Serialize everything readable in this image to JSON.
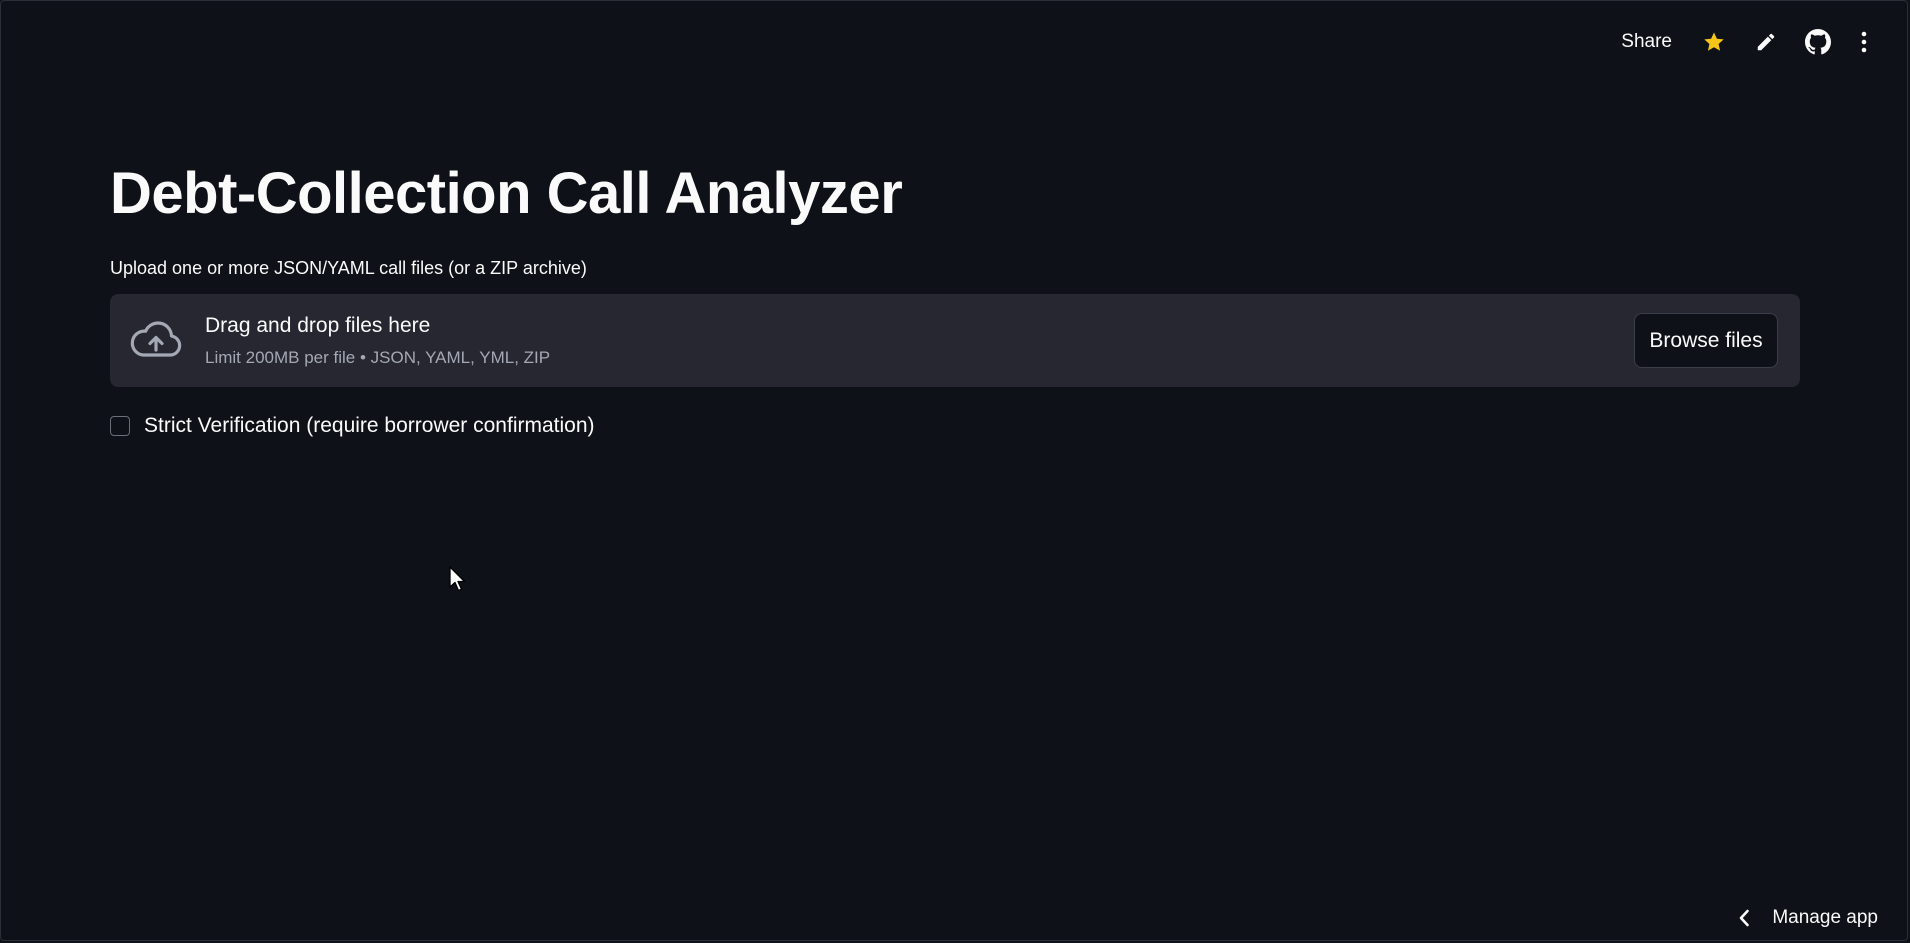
{
  "header": {
    "share_label": "Share",
    "icons": [
      "star-icon",
      "pencil-icon",
      "github-icon",
      "more-vertical-icon"
    ],
    "star_color": "#f5c518"
  },
  "main": {
    "title": "Debt-Collection Call Analyzer",
    "upload_label": "Upload one or more JSON/YAML call files (or a ZIP archive)",
    "dropzone": {
      "title": "Drag and drop files here",
      "subtitle": "Limit 200MB per file • JSON, YAML, YML, ZIP",
      "browse_label": "Browse files"
    },
    "strict_checkbox": {
      "label": "Strict Verification (require borrower confirmation)",
      "checked": false
    }
  },
  "footer": {
    "manage_label": "Manage app"
  },
  "colors": {
    "background": "#0e1117",
    "panel": "#262730",
    "text": "#fafafa",
    "muted_text": "#a3a8b4"
  }
}
